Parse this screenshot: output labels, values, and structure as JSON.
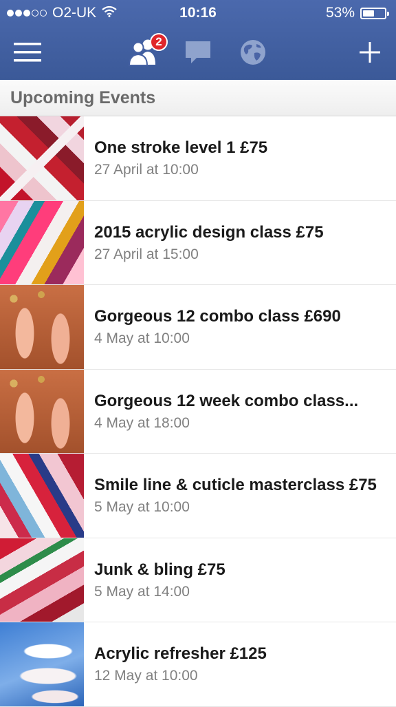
{
  "status_bar": {
    "carrier": "O2-UK",
    "time": "10:16",
    "battery": "53%",
    "battery_level": 0.53,
    "signal_bars_filled": 3,
    "signal_bars_total": 5
  },
  "navbar": {
    "menu_icon": "hamburger-menu-icon",
    "friend_requests_icon": "friend-requests-icon",
    "friend_requests_badge": "2",
    "messages_icon": "messages-icon",
    "notifications_icon": "globe-notifications-icon",
    "add_icon": "plus-icon",
    "colors": {
      "bar": "#3b5998",
      "badge": "#e0262b"
    }
  },
  "section": {
    "title": "Upcoming Events"
  },
  "events": [
    {
      "title": "One stroke level 1 £75",
      "time": "27 April at 10:00"
    },
    {
      "title": "2015 acrylic design class £75",
      "time": "27 April at 15:00"
    },
    {
      "title": "Gorgeous 12 combo class £690",
      "time": "4 May at 10:00"
    },
    {
      "title": "Gorgeous 12 week combo class...",
      "time": "4 May at 18:00"
    },
    {
      "title": "Smile line & cuticle masterclass £75",
      "time": "5 May at 10:00"
    },
    {
      "title": "Junk & bling £75",
      "time": "5 May at 14:00"
    },
    {
      "title": "Acrylic refresher £125",
      "time": "12 May at 10:00"
    }
  ]
}
